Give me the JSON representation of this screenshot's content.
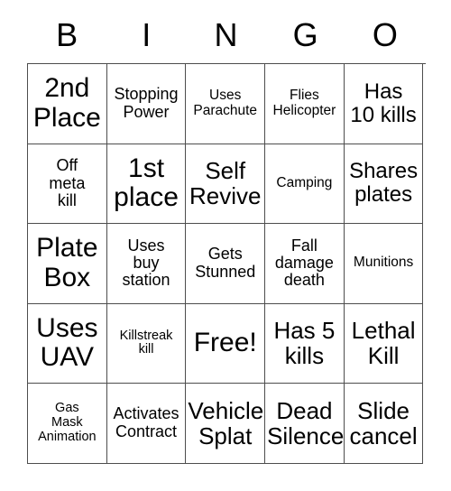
{
  "card": {
    "header_letters": [
      "B",
      "I",
      "N",
      "G",
      "O"
    ],
    "rows": [
      [
        {
          "text": "2nd\nPlace",
          "size": "fs-xl"
        },
        {
          "text": "Stopping\nPower",
          "size": "fs-sm"
        },
        {
          "text": "Uses\nParachute",
          "size": "fs-xs"
        },
        {
          "text": "Flies\nHelicopter",
          "size": "fs-xs"
        },
        {
          "text": "Has\n10 kills",
          "size": "fs-md"
        }
      ],
      [
        {
          "text": "Off\nmeta\nkill",
          "size": "fs-sm"
        },
        {
          "text": "1st\nplace",
          "size": "fs-xl"
        },
        {
          "text": "Self\nRevive",
          "size": "fs-lg"
        },
        {
          "text": "Camping",
          "size": "fs-xs"
        },
        {
          "text": "Shares\nplates",
          "size": "fs-md"
        }
      ],
      [
        {
          "text": "Plate\nBox",
          "size": "fs-xl"
        },
        {
          "text": "Uses\nbuy\nstation",
          "size": "fs-sm"
        },
        {
          "text": "Gets\nStunned",
          "size": "fs-sm"
        },
        {
          "text": "Fall\ndamage\ndeath",
          "size": "fs-sm"
        },
        {
          "text": "Munitions",
          "size": "fs-xs"
        }
      ],
      [
        {
          "text": "Uses\nUAV",
          "size": "fs-xl"
        },
        {
          "text": "Killstreak\nkill",
          "size": "fs-xxs"
        },
        {
          "text": "Free!",
          "size": "fs-xl"
        },
        {
          "text": "Has 5\nkills",
          "size": "fs-lg"
        },
        {
          "text": "Lethal\nKill",
          "size": "fs-lg"
        }
      ],
      [
        {
          "text": "Gas\nMask\nAnimation",
          "size": "fs-xxs"
        },
        {
          "text": "Activates\nContract",
          "size": "fs-sm"
        },
        {
          "text": "Vehicle\nSplat",
          "size": "fs-lg"
        },
        {
          "text": "Dead\nSilence",
          "size": "fs-lg"
        },
        {
          "text": "Slide\ncancel",
          "size": "fs-lg"
        }
      ]
    ]
  },
  "colors": {
    "background": "#ffffff",
    "text": "#000000",
    "border": "#4d4d4d"
  }
}
